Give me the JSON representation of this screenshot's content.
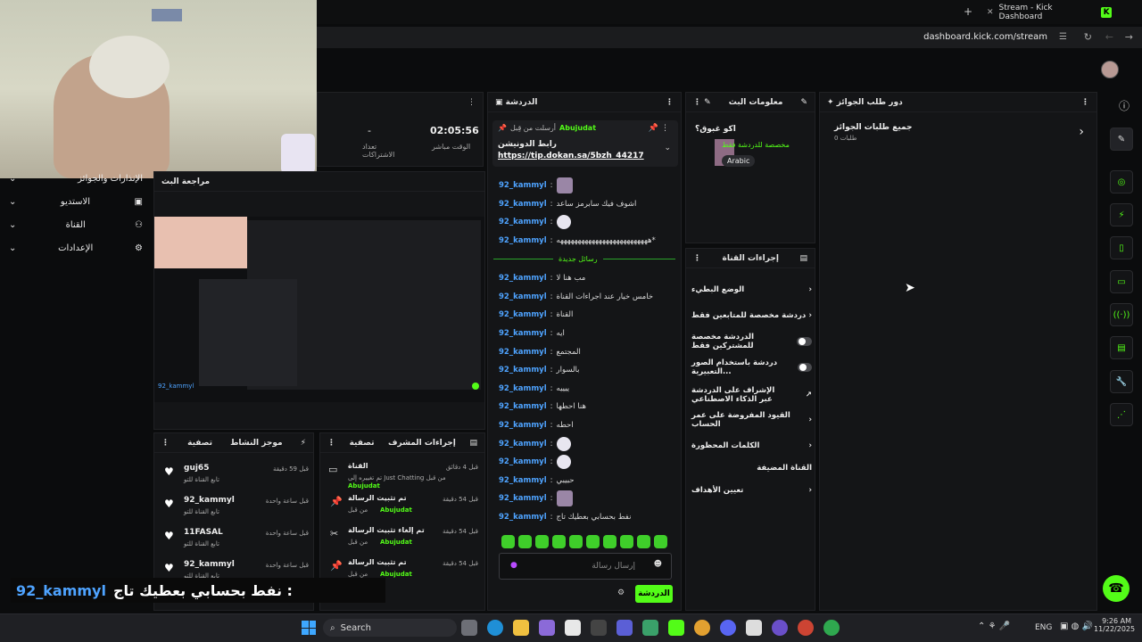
{
  "browser": {
    "tab_title": "Stream - Kick Dashboard",
    "tab_badge": "K",
    "new_tab": "+",
    "address": "dashboard.kick.com/stream"
  },
  "sidebar": {
    "items": [
      {
        "label": "الإنذارات والجوائز",
        "icon": "gift-icon"
      },
      {
        "label": "الاستديو",
        "icon": "studio-icon"
      },
      {
        "label": "القناة",
        "icon": "channel-icon"
      },
      {
        "label": "الإعدادات",
        "icon": "gear-icon"
      }
    ]
  },
  "stats": {
    "followers_value": "-",
    "followers_label": "تعداد الاشتراكات",
    "time_value": "02:05:56",
    "time_label": "الوقت مباشر"
  },
  "preview": {
    "title": "مراجعة البث",
    "username": "92_kammyl"
  },
  "chat": {
    "title": "الدردشة",
    "pinned_by_label": "أرسلت من قِبل",
    "pinned_by": "Abujudat",
    "pinned_title": "رابط الدونيشن",
    "pinned_link": "https://tip.dokan.sa/5bzh_44217",
    "new_messages": "رسائل جديدة",
    "messages_before": [
      {
        "user": "92_kammyl",
        "text": "",
        "emote": "pic"
      },
      {
        "user": "92_kammyl",
        "text": "اشوف فيك سابرمز ساعد",
        "emote": ""
      },
      {
        "user": "92_kammyl",
        "text": "",
        "emote": "unicorn"
      },
      {
        "user": "92_kammyl",
        "text": "ههههههههههههههههههههههههههه*",
        "emote": ""
      }
    ],
    "messages_after": [
      {
        "user": "92_kammyl",
        "text": "مب هنا لا",
        "emote": ""
      },
      {
        "user": "92_kammyl",
        "text": "خامس خيار عند اجراءات القناة",
        "emote": ""
      },
      {
        "user": "92_kammyl",
        "text": "القناة",
        "emote": ""
      },
      {
        "user": "92_kammyl",
        "text": "ايه",
        "emote": ""
      },
      {
        "user": "92_kammyl",
        "text": "المجتمع",
        "emote": ""
      },
      {
        "user": "92_kammyl",
        "text": "بالسوار",
        "emote": ""
      },
      {
        "user": "92_kammyl",
        "text": "ييييه",
        "emote": ""
      },
      {
        "user": "92_kammyl",
        "text": "هنا احطها",
        "emote": ""
      },
      {
        "user": "92_kammyl",
        "text": "احطه",
        "emote": ""
      },
      {
        "user": "92_kammyl",
        "text": "",
        "emote": "unicorn"
      },
      {
        "user": "92_kammyl",
        "text": "",
        "emote": "unicorn"
      },
      {
        "user": "92_kammyl",
        "text": "حبيبي",
        "emote": ""
      },
      {
        "user": "92_kammyl",
        "text": "",
        "emote": "pic"
      },
      {
        "user": "92_kammyl",
        "text": "نفط بحسابي بعطيك تاج",
        "emote": ""
      }
    ],
    "input_placeholder": "إرسال رسالة",
    "send_label": "الدردشة"
  },
  "stream_info": {
    "title": "معلومات البث",
    "stream_title": "اكو غبوق؟",
    "category": "مخصصة للدردشة فقط",
    "language": "Arabic"
  },
  "rewards": {
    "title": "دور طلب الجوائز",
    "item": "جميع طلبات الجوائز",
    "count": "0 طلبات"
  },
  "channel_actions": {
    "title": "إجراءات القناة",
    "items": [
      {
        "label": "الوضع البطيء",
        "kind": "chevron"
      },
      {
        "label": "دردشة مخصصة للمتابعين فقط",
        "kind": "chevron"
      },
      {
        "label": "الدردشة مخصصة للمشتركين فقط",
        "kind": "toggle"
      },
      {
        "label": "دردشة باستخدام الصور التعبيرية...",
        "kind": "toggle"
      },
      {
        "label": "الإشراف على الدردشة عبر الذكاء الاصطناعي",
        "kind": "link"
      },
      {
        "label": "القيود المفروضة على عمر الحساب",
        "kind": "chevron"
      },
      {
        "label": "الكلمات المحظورة",
        "kind": "chevron"
      },
      {
        "label": "القناة المضيفة",
        "kind": "none"
      },
      {
        "label": "تعيين الأهداف",
        "kind": "chevron"
      }
    ]
  },
  "activity": {
    "title": "موجز النشاط",
    "filter": "تصفية",
    "items": [
      {
        "user": "guj65",
        "action": "تابع القناة للتو",
        "time": "قبل 59 دقيقة"
      },
      {
        "user": "92_kammyl",
        "action": "تابع القناة للتو",
        "time": "قبل ساعة واحدة"
      },
      {
        "user": "11FASAL",
        "action": "تابع القناة للتو",
        "time": "قبل ساعة واحدة"
      },
      {
        "user": "92_kammyl",
        "action": "تابع القناة للتو",
        "time": "قبل ساعة واحدة"
      }
    ]
  },
  "mod_actions": {
    "title": "إجراءات المشرف",
    "filter": "تصفية",
    "items": [
      {
        "title": "القناة",
        "detail": "تم تغييره إلى Just Chatting من قبل",
        "by": "Abujudat",
        "time": "قبل 4 دقائق",
        "icon": "channel-icon"
      },
      {
        "title": "تم تثبيت الرسالة",
        "detail": "من قبل",
        "by": "Abujudat",
        "time": "قبل 54 دقيقة",
        "icon": "pin-icon"
      },
      {
        "title": "تم إلغاء تثبيت الرسالة",
        "detail": "من قبل",
        "by": "Abujudat",
        "time": "قبل 54 دقيقة",
        "icon": "unpin-icon"
      },
      {
        "title": "تم تثبيت الرسالة",
        "detail": "من قبل",
        "by": "Abujudat",
        "time": "قبل 54 دقيقة",
        "icon": "pin-icon"
      }
    ]
  },
  "caption": {
    "user": "92_kammyl",
    "text": "نفط بحسابي بعطيك تاج :"
  },
  "taskbar": {
    "search": "Search",
    "lang": "ENG",
    "time": "9:26 AM",
    "date": "11/22/2025"
  },
  "colors": {
    "accent": "#53fc18",
    "username": "#4ea3ff",
    "panel": "#141517"
  }
}
